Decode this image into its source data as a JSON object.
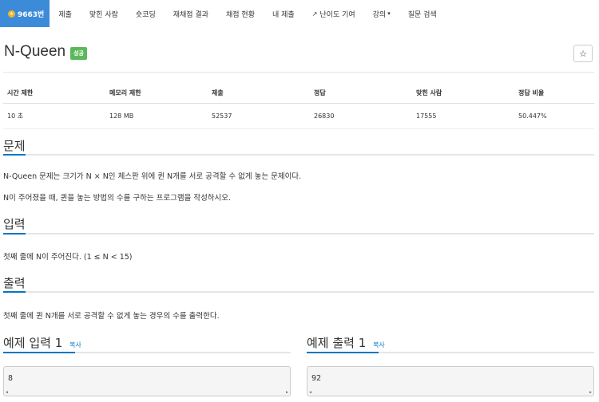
{
  "nav": {
    "items": [
      {
        "label": "9663번",
        "active": true
      },
      {
        "label": "제출"
      },
      {
        "label": "맞힌 사람"
      },
      {
        "label": "숏코딩"
      },
      {
        "label": "재채점 결과"
      },
      {
        "label": "채점 현황"
      },
      {
        "label": "내 제출"
      },
      {
        "label": "난이도 기여"
      },
      {
        "label": "강의"
      },
      {
        "label": "질문 검색"
      }
    ]
  },
  "problem": {
    "title": "N-Queen",
    "badge": "성공",
    "star": "☆"
  },
  "stats": {
    "headers": [
      "시간 제한",
      "메모리 제한",
      "제출",
      "정답",
      "맞힌 사람",
      "정답 비율"
    ],
    "values": [
      "10 초",
      "128 MB",
      "52537",
      "26830",
      "17555",
      "50.447%"
    ]
  },
  "sections": {
    "problem_head": "문제",
    "problem_text_1": "N-Queen 문제는 크기가 N × N인 체스판 위에 퀸 N개를 서로 공격할 수 없게 놓는 문제이다.",
    "problem_text_2": "N이 주어졌을 때, 퀸을 놓는 방법의 수를 구하는 프로그램을 작성하시오.",
    "input_head": "입력",
    "input_text": "첫째 줄에 N이 주어진다. (1 ≤ N < 15)",
    "output_head": "출력",
    "output_text": "첫째 줄에 퀸 N개를 서로 공격할 수 없게 놓는 경우의 수를 출력한다."
  },
  "samples": {
    "input_head": "예제 입력 1",
    "output_head": "예제 출력 1",
    "copy_label": "복사",
    "input_value": "8",
    "output_value": "92"
  },
  "colors": {
    "accent": "#0076C0",
    "nav_active": "#3C8BD9",
    "success": "#5cb85c"
  }
}
